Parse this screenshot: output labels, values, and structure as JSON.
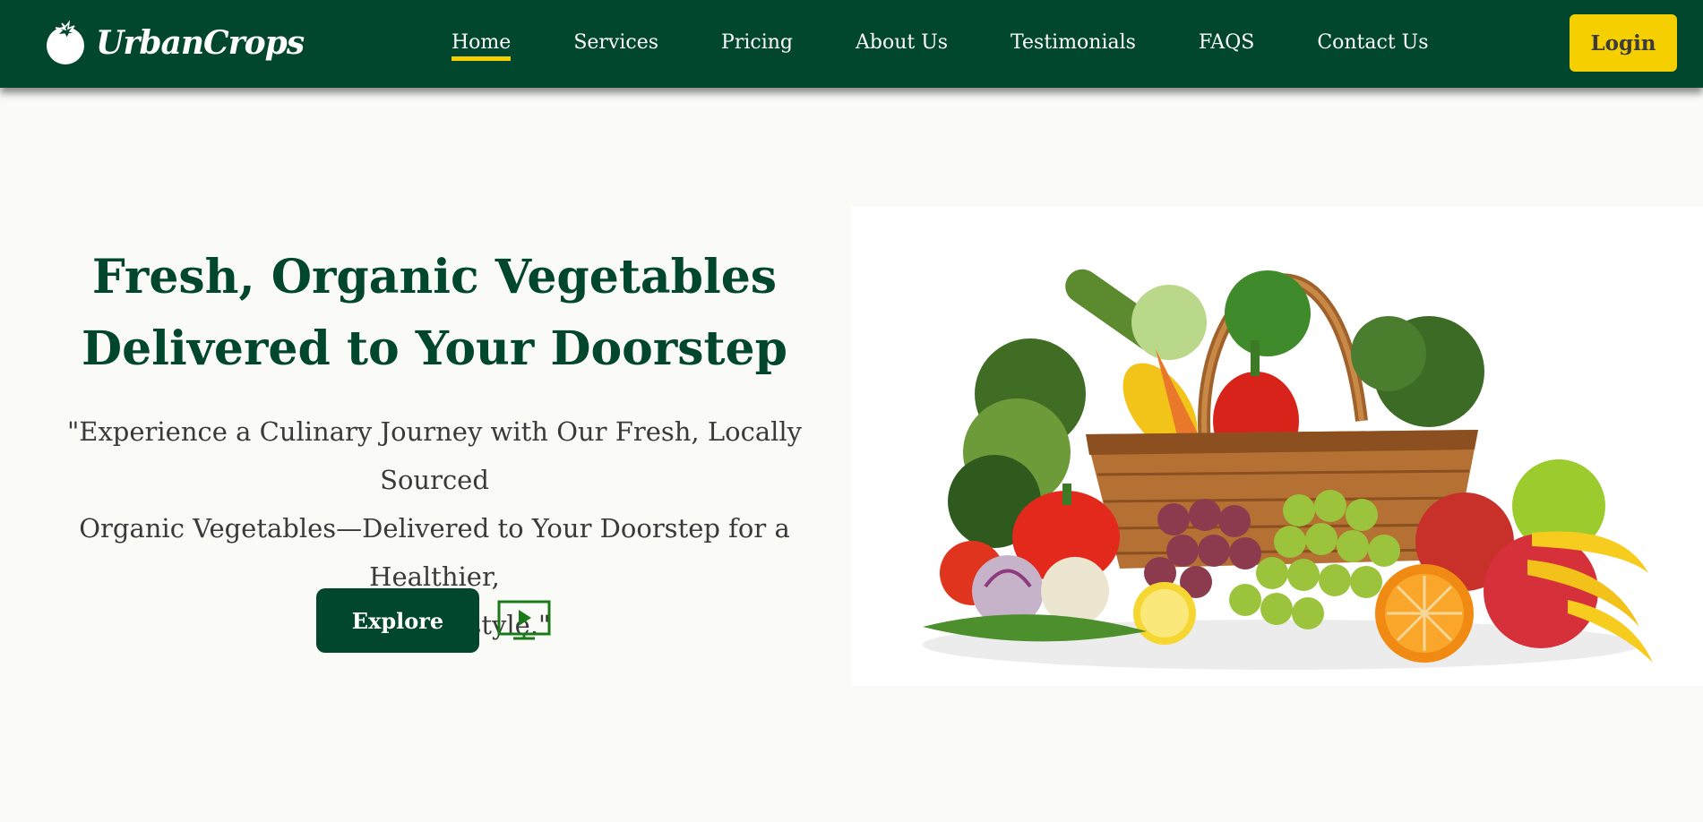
{
  "brand": {
    "name": "UrbanCrops",
    "logo_icon": "tomato-icon"
  },
  "nav": {
    "items": [
      {
        "label": "Home",
        "active": true
      },
      {
        "label": "Services",
        "active": false
      },
      {
        "label": "Pricing",
        "active": false
      },
      {
        "label": "About Us",
        "active": false
      },
      {
        "label": "Testimonials",
        "active": false
      },
      {
        "label": "FAQS",
        "active": false
      },
      {
        "label": "Contact Us",
        "active": false
      }
    ],
    "login_label": "Login"
  },
  "hero": {
    "title_line1": "Fresh, Organic Vegetables",
    "title_line2": "Delivered to Your Doorstep",
    "subtitle_line1": "\"Experience a Culinary Journey with Our Fresh, Locally Sourced",
    "subtitle_line2": "Organic Vegetables—Delivered to Your Doorstep for a Healthier,",
    "subtitle_line3": "Tastier Lifestyle.\"",
    "explore_label": "Explore",
    "video_icon": "play-video-icon",
    "image_subject": "wicker basket of vegetables and fruits"
  },
  "colors": {
    "brand_green": "#00472d",
    "accent_yellow": "#f5cf00",
    "page_background": "#fafaf7",
    "video_icon_green": "#1a7a1a"
  }
}
